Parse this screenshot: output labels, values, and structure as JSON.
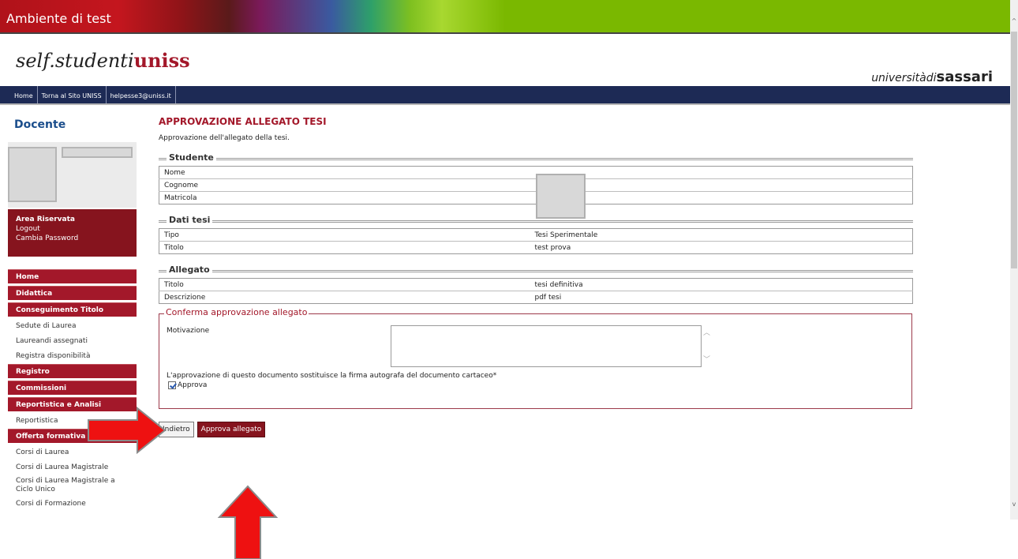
{
  "banner": {
    "label": "Ambiente di test"
  },
  "brand": {
    "logo_prefix": "self.studenti",
    "logo_suffix": "uniss",
    "university_a": "università",
    "university_b": "di",
    "university_c": "sassari"
  },
  "nav": {
    "items": [
      "Home",
      "Torna al Sito UNISS",
      "helpesse3@uniss.it"
    ]
  },
  "sidebar": {
    "title": "Docente",
    "area": {
      "title": "Area Riservata",
      "links": [
        "Logout",
        "Cambia Password"
      ]
    },
    "menu": [
      {
        "type": "head",
        "label": "Home"
      },
      {
        "type": "head",
        "label": "Didattica"
      },
      {
        "type": "head",
        "label": "Conseguimento Titolo"
      },
      {
        "type": "link",
        "label": "Sedute di Laurea"
      },
      {
        "type": "link",
        "label": "Laureandi assegnati"
      },
      {
        "type": "link",
        "label": "Registra disponibilità"
      },
      {
        "type": "head",
        "label": "Registro"
      },
      {
        "type": "head",
        "label": "Commissioni"
      },
      {
        "type": "head",
        "label": "Reportistica e Analisi"
      },
      {
        "type": "link",
        "label": "Reportistica"
      },
      {
        "type": "head",
        "label": "Offerta formativa"
      },
      {
        "type": "link",
        "label": "Corsi di Laurea"
      },
      {
        "type": "link",
        "label": "Corsi di Laurea Magistrale"
      },
      {
        "type": "link",
        "label": "Corsi di Laurea Magistrale a Ciclo Unico"
      },
      {
        "type": "link",
        "label": "Corsi di Formazione"
      }
    ]
  },
  "main": {
    "title": "APPROVAZIONE ALLEGATO TESI",
    "subtitle": "Approvazione dell'allegato della tesi.",
    "studente": {
      "legend": "Studente",
      "rows": [
        [
          "Nome",
          ""
        ],
        [
          "Cognome",
          ""
        ],
        [
          "Matricola",
          ""
        ]
      ]
    },
    "dati_tesi": {
      "legend": "Dati tesi",
      "rows": [
        [
          "Tipo",
          "Tesi Sperimentale"
        ],
        [
          "Titolo",
          "test prova"
        ]
      ]
    },
    "allegato": {
      "legend": "Allegato",
      "rows": [
        [
          "Titolo",
          "tesi definitiva"
        ],
        [
          "Descrizione",
          "pdf tesi"
        ]
      ]
    },
    "conferma": {
      "legend": "Conferma approvazione allegato",
      "motivazione_label": "Motivazione",
      "motivazione_value": "",
      "legal_text": "L'approvazione di questo documento sostituisce la firma autografa del documento cartaceo*",
      "checkbox_label": "Approva",
      "checkbox_checked": true
    },
    "buttons": {
      "back": "Indietro",
      "approve": "Approva allegato"
    }
  },
  "colors": {
    "brand_red": "#a3182a",
    "dark_red": "#86141e",
    "nav_blue": "#1d2a55",
    "arrow_red": "#ee1111"
  },
  "icons": {
    "arrows": [
      "red-arrow-right-icon",
      "red-arrow-up-icon"
    ],
    "scroll": [
      "chevron-up-icon",
      "chevron-down-icon"
    ]
  }
}
